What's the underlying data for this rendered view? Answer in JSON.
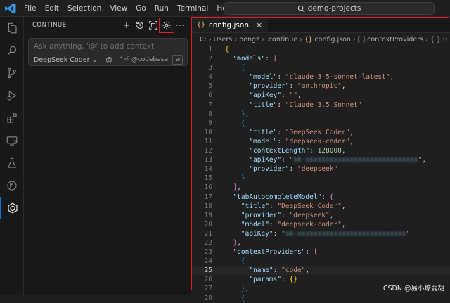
{
  "menu": [
    "File",
    "Edit",
    "Selection",
    "View",
    "Go",
    "Run",
    "Terminal",
    "Help"
  ],
  "search": {
    "text": "demo-projects"
  },
  "panel": {
    "title": "CONTINUE",
    "chat_placeholder": "Ask anything, '@' to add context",
    "model": "DeepSeek Coder",
    "at": "@",
    "hint": "^⏎ @codebase",
    "enter": "⏎"
  },
  "editor": {
    "tab": {
      "name": "config.json",
      "close": "×",
      "glyph": "{}"
    },
    "breadcrumb": [
      "C:",
      "Users",
      "pengz",
      ".continue",
      "config.json",
      "[ ] contextProviders",
      "{ } 0"
    ],
    "current_line": 25
  },
  "code_lines": [
    {
      "n": "1",
      "t": [
        [
          "b1",
          "{"
        ]
      ]
    },
    {
      "n": "2",
      "t": [
        [
          "txt",
          "  "
        ],
        [
          "k",
          "\"models\""
        ],
        [
          "txt",
          ": "
        ],
        [
          "b2",
          "["
        ]
      ]
    },
    {
      "n": "3",
      "t": [
        [
          "txt",
          "    "
        ],
        [
          "b3",
          "{"
        ]
      ]
    },
    {
      "n": "4",
      "t": [
        [
          "txt",
          "      "
        ],
        [
          "k",
          "\"model\""
        ],
        [
          "txt",
          ": "
        ],
        [
          "s",
          "\"claude-3-5-sonnet-latest\""
        ],
        [
          "txt",
          ","
        ]
      ]
    },
    {
      "n": "5",
      "t": [
        [
          "txt",
          "      "
        ],
        [
          "k",
          "\"provider\""
        ],
        [
          "txt",
          ": "
        ],
        [
          "s",
          "\"anthropic\""
        ],
        [
          "txt",
          ","
        ]
      ]
    },
    {
      "n": "6",
      "t": [
        [
          "txt",
          "      "
        ],
        [
          "k",
          "\"apiKey\""
        ],
        [
          "txt",
          ": "
        ],
        [
          "s",
          "\"\""
        ],
        [
          "txt",
          ","
        ]
      ]
    },
    {
      "n": "7",
      "t": [
        [
          "txt",
          "      "
        ],
        [
          "k",
          "\"title\""
        ],
        [
          "txt",
          ": "
        ],
        [
          "s",
          "\"Claude 3.5 Sonnet\""
        ]
      ]
    },
    {
      "n": "8",
      "t": [
        [
          "txt",
          "    "
        ],
        [
          "b3",
          "}"
        ],
        [
          "txt",
          ","
        ]
      ]
    },
    {
      "n": "9",
      "t": [
        [
          "txt",
          "    "
        ],
        [
          "b3",
          "{"
        ]
      ]
    },
    {
      "n": "10",
      "t": [
        [
          "txt",
          "      "
        ],
        [
          "k",
          "\"title\""
        ],
        [
          "txt",
          ": "
        ],
        [
          "s",
          "\"DeepSeek Coder\""
        ],
        [
          "txt",
          ","
        ]
      ]
    },
    {
      "n": "11",
      "t": [
        [
          "txt",
          "      "
        ],
        [
          "k",
          "\"model\""
        ],
        [
          "txt",
          ": "
        ],
        [
          "s",
          "\"deepseek-coder\""
        ],
        [
          "txt",
          ","
        ]
      ]
    },
    {
      "n": "12",
      "t": [
        [
          "txt",
          "      "
        ],
        [
          "k",
          "\"contextLength\""
        ],
        [
          "txt",
          ": "
        ],
        [
          "n",
          "128000"
        ],
        [
          "txt",
          ","
        ]
      ]
    },
    {
      "n": "13",
      "t": [
        [
          "txt",
          "      "
        ],
        [
          "k",
          "\"apiKey\""
        ],
        [
          "txt",
          ": "
        ],
        [
          "s",
          "\""
        ],
        [
          "blur",
          "sk-xxxxxxxxxxxxxxxxxxxxxxxxxxxx"
        ],
        [
          "s",
          "\""
        ],
        [
          "txt",
          ","
        ]
      ]
    },
    {
      "n": "14",
      "t": [
        [
          "txt",
          "      "
        ],
        [
          "k",
          "\"provider\""
        ],
        [
          "txt",
          ": "
        ],
        [
          "s",
          "\"deepseek\""
        ]
      ]
    },
    {
      "n": "15",
      "t": [
        [
          "txt",
          "    "
        ],
        [
          "b3",
          "}"
        ]
      ]
    },
    {
      "n": "16",
      "t": [
        [
          "txt",
          "  "
        ],
        [
          "b2",
          "]"
        ],
        [
          "txt",
          ","
        ]
      ]
    },
    {
      "n": "17",
      "t": [
        [
          "txt",
          "  "
        ],
        [
          "k",
          "\"tabAutocompleteModel\""
        ],
        [
          "txt",
          ": "
        ],
        [
          "b2",
          "{"
        ]
      ]
    },
    {
      "n": "18",
      "t": [
        [
          "txt",
          "    "
        ],
        [
          "k",
          "\"title\""
        ],
        [
          "txt",
          ": "
        ],
        [
          "s",
          "\"DeepSeek Coder\""
        ],
        [
          "txt",
          ","
        ]
      ]
    },
    {
      "n": "19",
      "t": [
        [
          "txt",
          "    "
        ],
        [
          "k",
          "\"provider\""
        ],
        [
          "txt",
          ": "
        ],
        [
          "s",
          "\"deepseek\""
        ],
        [
          "txt",
          ","
        ]
      ]
    },
    {
      "n": "20",
      "t": [
        [
          "txt",
          "    "
        ],
        [
          "k",
          "\"model\""
        ],
        [
          "txt",
          ": "
        ],
        [
          "s",
          "\"deepseek-coder\""
        ],
        [
          "txt",
          ","
        ]
      ]
    },
    {
      "n": "21",
      "t": [
        [
          "txt",
          "    "
        ],
        [
          "k",
          "\"apiKey\""
        ],
        [
          "txt",
          ": "
        ],
        [
          "s",
          "\""
        ],
        [
          "blur",
          "sk-xxxxxxxxxxxxxxxxxxxxxxxxxxx"
        ],
        [
          "s",
          "\""
        ]
      ]
    },
    {
      "n": "22",
      "t": [
        [
          "txt",
          "  "
        ],
        [
          "b2",
          "}"
        ],
        [
          "txt",
          ","
        ]
      ]
    },
    {
      "n": "23",
      "t": [
        [
          "txt",
          "  "
        ],
        [
          "k",
          "\"contextProviders\""
        ],
        [
          "txt",
          ": "
        ],
        [
          "b2",
          "["
        ]
      ]
    },
    {
      "n": "24",
      "t": [
        [
          "txt",
          "    "
        ],
        [
          "b3",
          "{"
        ]
      ]
    },
    {
      "n": "25",
      "t": [
        [
          "txt",
          "      "
        ],
        [
          "k",
          "\"name\""
        ],
        [
          "txt",
          ": "
        ],
        [
          "s",
          "\"code\""
        ],
        [
          "txt",
          ","
        ]
      ]
    },
    {
      "n": "26",
      "t": [
        [
          "txt",
          "      "
        ],
        [
          "k",
          "\"params\""
        ],
        [
          "txt",
          ": "
        ],
        [
          "b1",
          "{}"
        ]
      ]
    },
    {
      "n": "27",
      "t": [
        [
          "txt",
          "    "
        ],
        [
          "b3",
          "}"
        ],
        [
          "txt",
          ","
        ]
      ]
    },
    {
      "n": "28",
      "t": [
        [
          "txt",
          "    "
        ],
        [
          "b3",
          "{"
        ]
      ]
    }
  ],
  "activity_icons": [
    "explorer-icon",
    "search-icon",
    "source-control-icon",
    "run-debug-icon",
    "extensions-icon",
    "remote-explorer-icon",
    "testing-icon",
    "gitlens-icon",
    "continue-icon"
  ],
  "watermark": "CSDN @易小燎弱胡",
  "colors": {
    "accent": "#0078d4",
    "highlight_frame": "#d81e1e"
  }
}
